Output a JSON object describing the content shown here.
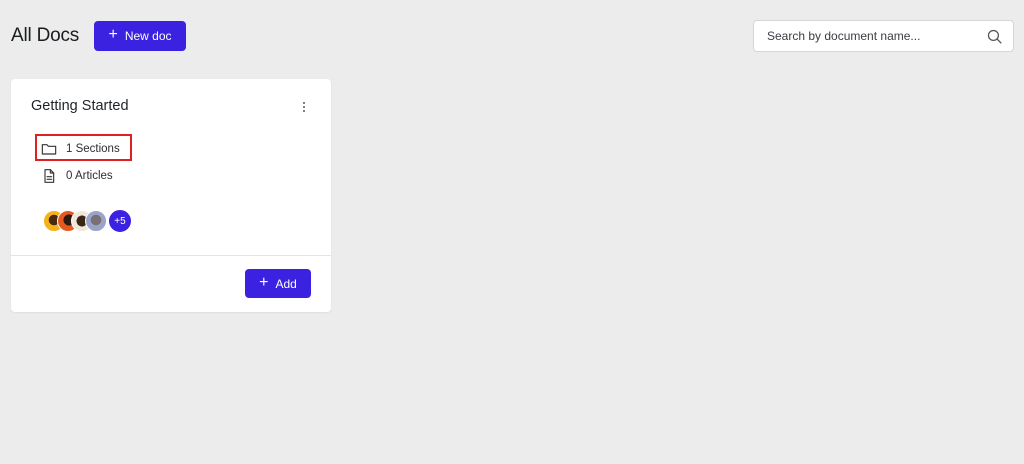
{
  "header": {
    "title": "All Docs",
    "new_doc_label": "New doc",
    "search_placeholder": "Search by document name..."
  },
  "card": {
    "title": "Getting Started",
    "sections_label": "1 Sections",
    "articles_label": "0 Articles",
    "avatars_more": "+5",
    "add_label": "Add"
  },
  "icons": {
    "search": "search-icon",
    "kebab": "more-vertical-icon",
    "folder": "folder-icon",
    "document": "document-icon",
    "plus": "plus-icon"
  },
  "colors": {
    "primary": "#3b22e0",
    "background": "#ececec",
    "highlight": "#e02020"
  }
}
